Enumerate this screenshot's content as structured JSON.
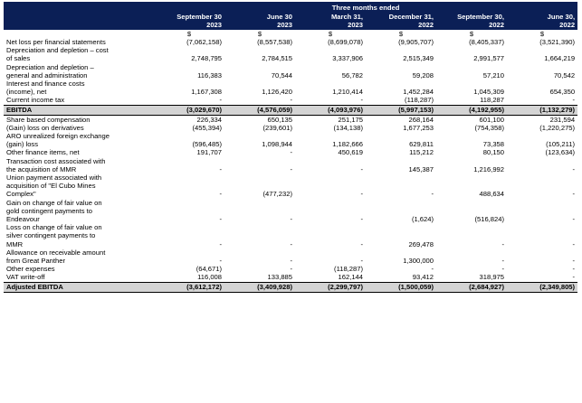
{
  "header": {
    "group_label": "Three months ended",
    "columns": [
      {
        "line1": "September 30",
        "line2": "2023"
      },
      {
        "line1": "June 30",
        "line2": "2023"
      },
      {
        "line1": "March 31,",
        "line2": "2023"
      },
      {
        "line1": "December 31,",
        "line2": "2022"
      },
      {
        "line1": "September 30,",
        "line2": "2022"
      },
      {
        "line1": "June 30,",
        "line2": "2022"
      }
    ]
  },
  "currency_symbol": "$",
  "rows": [
    {
      "label": [
        "Net loss per financial statements"
      ],
      "values": [
        "(7,062,158)",
        "(8,557,538)",
        "(8,699,078)",
        "(9,905,707)",
        "(8,405,337)",
        "(3,521,390)"
      ]
    },
    {
      "label": [
        "Depreciation and depletion – cost",
        "of sales"
      ],
      "values": [
        "2,748,795",
        "2,784,515",
        "3,337,906",
        "2,515,349",
        "2,991,577",
        "1,664,219"
      ]
    },
    {
      "label": [
        "Depreciation and depletion –",
        "general and administration"
      ],
      "values": [
        "116,383",
        "70,544",
        "56,782",
        "59,208",
        "57,210",
        "70,542"
      ]
    },
    {
      "label": [
        "Interest and finance costs",
        "(income), net"
      ],
      "values": [
        "1,167,308",
        "1,126,420",
        "1,210,414",
        "1,452,284",
        "1,045,309",
        "654,350"
      ]
    },
    {
      "label": [
        "Current income tax"
      ],
      "values": [
        "-",
        "-",
        "-",
        "(118,287)",
        "118,287",
        "-"
      ]
    },
    {
      "label": [
        "EBITDA"
      ],
      "values": [
        "(3,029,670)",
        "(4,576,059)",
        "(4,093,976)",
        "(5,997,153)",
        "(4,192,955)",
        "(1,132,279)"
      ],
      "total": true
    },
    {
      "label": [
        "Share based compensation"
      ],
      "values": [
        "226,334",
        "650,135",
        "251,175",
        "268,164",
        "601,100",
        "231,594"
      ]
    },
    {
      "label": [
        "(Gain) loss on derivatives"
      ],
      "values": [
        "(455,394)",
        "(239,601)",
        "(134,138)",
        "1,677,253",
        "(754,358)",
        "(1,220,275)"
      ]
    },
    {
      "label": [
        "ARO unrealized foreign exchange",
        "(gain) loss"
      ],
      "values": [
        "(596,485)",
        "1,098,944",
        "1,182,666",
        "629,811",
        "73,358",
        "(105,211)"
      ]
    },
    {
      "label": [
        "Other finance items, net"
      ],
      "values": [
        "191,707",
        "-",
        "450,619",
        "115,212",
        "80,150",
        "(123,634)"
      ]
    },
    {
      "label": [
        "Transaction cost associated with",
        "the acquisition of MMR"
      ],
      "values": [
        "-",
        "-",
        "-",
        "145,387",
        "1,216,992",
        "-"
      ]
    },
    {
      "label": [
        "Union payment associated with",
        "acquisition of \"El Cubo Mines",
        "Complex\""
      ],
      "values": [
        "-",
        "(477,232)",
        "-",
        "-",
        "488,634",
        "-"
      ]
    },
    {
      "label": [
        "Gain on change of fair value on",
        "gold contingent payments to",
        "Endeavour"
      ],
      "values": [
        "-",
        "-",
        "-",
        "(1,624)",
        "(516,824)",
        "-"
      ]
    },
    {
      "label": [
        "Loss on change of fair value on",
        "silver contingent payments to",
        "MMR"
      ],
      "values": [
        "-",
        "-",
        "-",
        "269,478",
        "-",
        "-"
      ]
    },
    {
      "label": [
        "Allowance on receivable amount",
        "from Great Panther"
      ],
      "values": [
        "-",
        "-",
        "-",
        "1,300,000",
        "-",
        "-"
      ]
    },
    {
      "label": [
        "Other expenses"
      ],
      "values": [
        "(64,671)",
        "-",
        "(118,287)",
        "-",
        "-",
        "-"
      ]
    },
    {
      "label": [
        "VAT write-off"
      ],
      "values": [
        "116,008",
        "133,885",
        "162,144",
        "93,412",
        "318,975",
        "-"
      ]
    },
    {
      "label": [
        "Adjusted EBITDA"
      ],
      "values": [
        "(3,612,172)",
        "(3,409,928)",
        "(2,299,797)",
        "(1,500,059)",
        "(2,684,927)",
        "(2,349,805)"
      ],
      "total": true
    }
  ]
}
